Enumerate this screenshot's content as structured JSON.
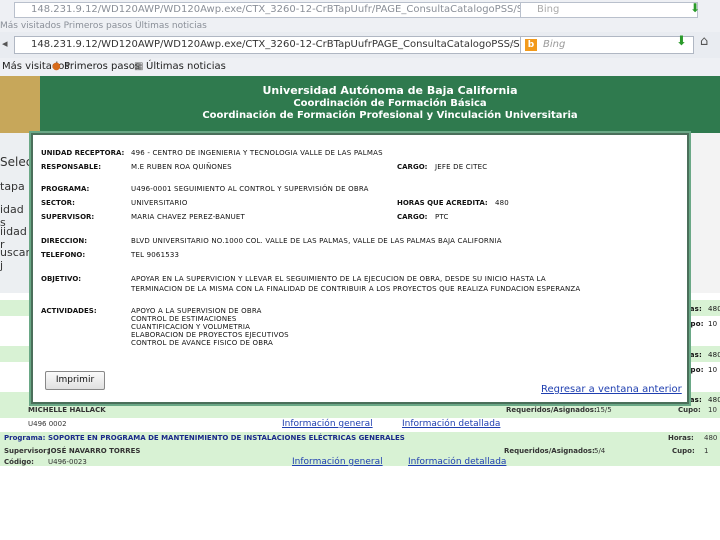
{
  "browser": {
    "url": "148.231.9.12/WD120AWP/WD120Awp.exe/CTX_3260-12-CrBTapUufrPAGE_ConsultaCatalogoPSS/SYNC_17944526",
    "ghost_url": "148.231.9.12/WD120AWP/WD120Awp.exe/CTX_3260-12-CrBTapUufr/PAGE_ConsultaCatalogoPSS/SYNC_17944493",
    "search_placeholder": "Bing",
    "ghost_bookmarks": "Más visitados   Primeros pasos   Últimas noticias",
    "bookmarks": [
      "Más visitados",
      "Primeros pasos",
      "Últimas noticias"
    ]
  },
  "header": {
    "line1": "Universidad Autónoma de Baja California",
    "line2": "Coordinación de Formación Básica",
    "line3": "Coordinación de Formación Profesional y Vinculación Universitaria"
  },
  "modal": {
    "unidad_label": "UNIDAD RECEPTORA:",
    "unidad_value": "496 - CENTRO DE INGENIERIA Y TECNOLOGIA VALLE DE LAS PALMAS",
    "responsable_label": "RESPONSABLE:",
    "responsable_value": "M.E RUBEN ROA QUIÑONES",
    "cargo_label": "CARGO:",
    "cargo1_value": "JEFE DE CITEC",
    "programa_label": "PROGRAMA:",
    "programa_value": "U496-0001   SEGUIMIENTO AL CONTROL Y SUPERVISIÓN DE OBRA",
    "sector_label": "SECTOR:",
    "sector_value": "UNIVERSITARIO",
    "horas_label": "HORAS QUE ACREDITA:",
    "horas_value": "480",
    "supervisor_label": "SUPERVISOR:",
    "supervisor_value": "MARIA CHAVEZ PEREZ-BANUET",
    "cargo2_value": "PTC",
    "direccion_label": "DIRECCION:",
    "direccion_value": "BLVD UNIVERSITARIO NO.1000 COL. VALLE DE LAS PALMAS, VALLE DE LAS PALMAS BAJA CALIFORNIA",
    "telefono_label": "TELEFONO:",
    "telefono_value": "TEL 9061533",
    "objetivo_label": "OBJETIVO:",
    "objetivo_line1": "APOYAR EN LA SUPERVICION Y LLEVAR EL SEGUIMIENTO DE LA EJECUCION DE OBRA, DESDE SU INICIO HASTA LA",
    "objetivo_line2": "TERMINACION DE LA MISMA CON LA FINALIDAD DE CONTRIBUIR A LOS PROYECTOS QUE REALIZA FUNDACION ESPERANZA",
    "actividades_label": "ACTIVIDADES:",
    "actividades": [
      "APOYO A LA SUPERVISION DE OBRA",
      "CONTROL DE ESTIMACIONES",
      "CUANTIFICACION Y VOLUMETRIA",
      "ELABORACION DE PROYECTOS EJECUTIVOS",
      "CONTROL DE AVANCE FISICO DE OBRA"
    ],
    "print_button": "Imprimir",
    "back_link": "Regresar a ventana anterior"
  },
  "background": {
    "left_labels": [
      "Selecc",
      "tapa",
      "idad s",
      "iidad r",
      "uscar j"
    ],
    "row_a_supervisor": "MICHELLE HALLACK",
    "row_a_requeridos": "Requeridos/Asignados:",
    "row_a_req_value": "15/5",
    "row_a_cupo": "Cupo:",
    "row_a_cupo_value": "10",
    "row_a_code": "U496 0002",
    "info_general": "Información general",
    "info_detallada": "Información detallada",
    "row_b_program_label": "Programa:",
    "row_b_program": "SOPORTE EN PROGRAMA DE MANTENIMIENTO DE INSTALACIONES ELÉCTRICAS GENERALES",
    "row_b_horas": "Horas:",
    "row_b_horas_value": "480",
    "row_b_supervisor_label": "Supervisor:",
    "row_b_supervisor": "JOSÉ NAVARRO TORRES",
    "row_b_requeridos": "Requeridos/Asignados:",
    "row_b_req_value": "5/4",
    "row_b_cupo": "Cupo:",
    "row_b_cupo_value": "1",
    "row_b_codigo_label": "Código:",
    "row_b_codigo": "U496-0023",
    "right_values": [
      "Horas:",
      "480",
      "Cupo:",
      "10",
      "Horas:",
      "480",
      "Cupo:",
      "10",
      "Horas:",
      "480",
      "Cupo:",
      "10"
    ]
  }
}
